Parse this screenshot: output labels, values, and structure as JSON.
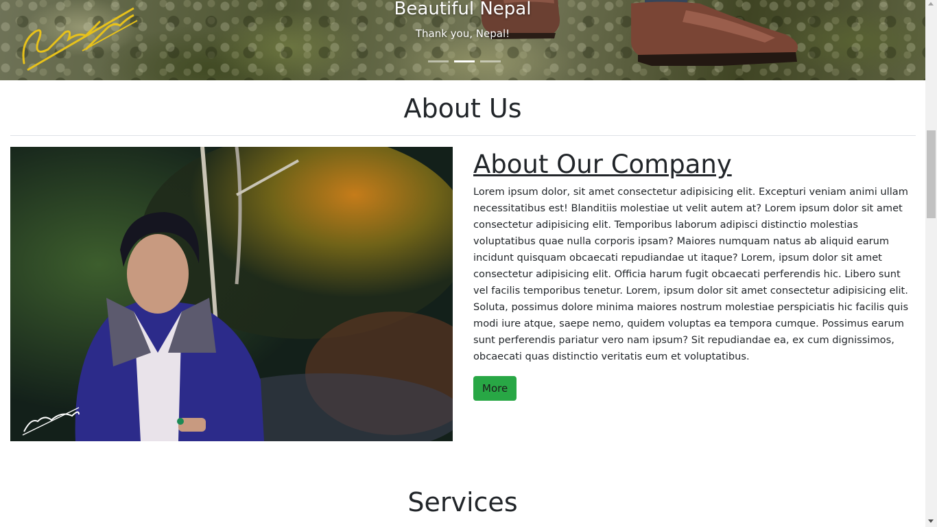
{
  "hero": {
    "title": "Beautiful Nepal",
    "subtitle": "Thank you, Nepal!",
    "indicators": [
      {
        "label": "slide-1",
        "active": false
      },
      {
        "label": "slide-2",
        "active": true
      },
      {
        "label": "slide-3",
        "active": false
      }
    ],
    "signature_color": "#e8c21a"
  },
  "about": {
    "section_title": "About Us",
    "company_title": "About Our Company",
    "body": "Lorem ipsum dolor, sit amet consectetur adipisicing elit. Excepturi veniam animi ullam necessitatibus est! Blanditiis molestiae ut velit autem at? Lorem ipsum dolor sit amet consectetur adipisicing elit. Temporibus laborum adipisci distinctio molestias voluptatibus quae nulla corporis ipsam? Maiores numquam natus ab aliquid earum incidunt quisquam obcaecati repudiandae ut itaque? Lorem, ipsum dolor sit amet consectetur adipisicing elit. Officia harum fugit obcaecati perferendis hic. Libero sunt vel facilis temporibus tenetur. Lorem, ipsum dolor sit amet consectetur adipisicing elit. Soluta, possimus dolore minima maiores nostrum molestiae perspiciatis hic facilis quis modi iure atque, saepe nemo, quidem voluptas ea tempora cumque. Possimus earum sunt perferendis pariatur vero nam ipsum? Sit repudiandae ea, ex cum dignissimos, obcaecati quas distinctio veritatis eum et voluptatibus.",
    "more_label": "More",
    "button_color": "#28a745"
  },
  "services": {
    "section_title": "Services"
  }
}
